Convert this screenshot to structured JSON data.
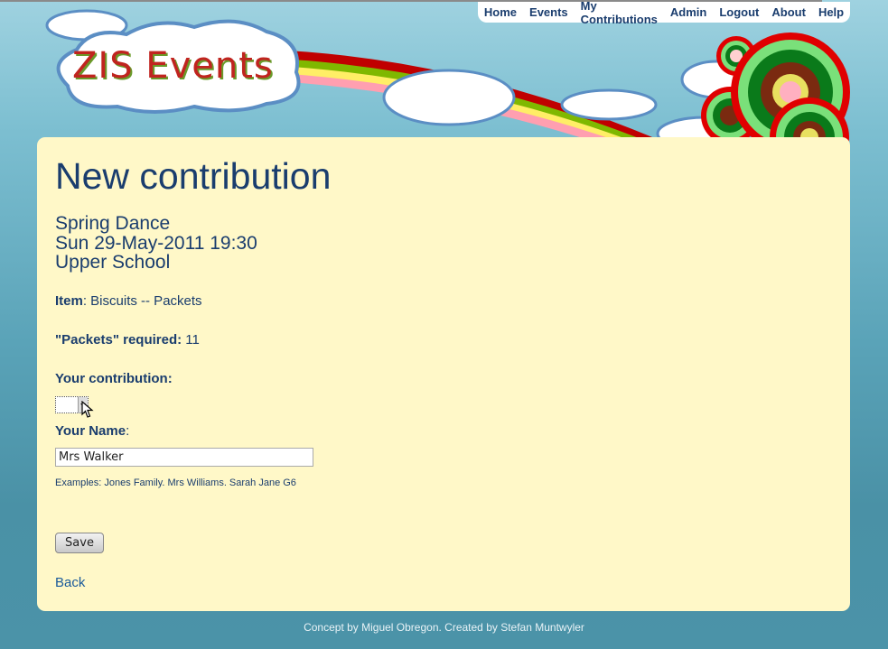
{
  "nav": {
    "items": [
      "Home",
      "Events",
      "My Contributions",
      "Admin",
      "Logout",
      "About",
      "Help"
    ]
  },
  "header": {
    "logo_text": "ZIS Events"
  },
  "page": {
    "title": "New contribution",
    "event_name": "Spring Dance",
    "event_datetime": "Sun 29-May-2011 19:30",
    "event_location": "Upper School"
  },
  "form": {
    "item_label": "Item",
    "item_value": ": Biscuits -- Packets",
    "required_label": "\"Packets\" required:",
    "required_value": "11",
    "contribution_label": "Your contribution:",
    "contribution_value": "",
    "name_label": "Your Name",
    "name_suffix": ":",
    "name_value": "Mrs Walker",
    "examples": "Examples: Jones Family. Mrs Williams. Sarah Jane G6",
    "save_label": "Save",
    "back_label": "Back"
  },
  "footer": {
    "text": "Concept by Miguel Obregon. Created by Stefan Muntwyler"
  },
  "colors": {
    "card_bg": "#fff8c8",
    "heading": "#1a3d6e",
    "link": "#1a5a9a"
  }
}
